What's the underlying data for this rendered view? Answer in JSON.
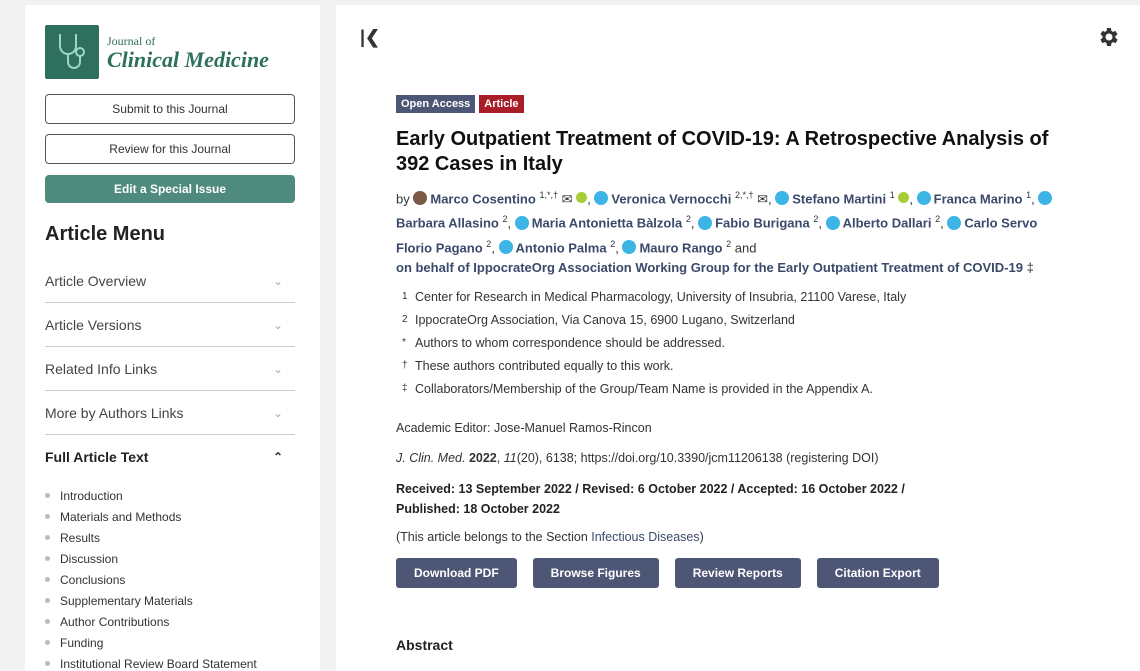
{
  "journal": {
    "line1": "Journal of",
    "line2": "Clinical Medicine"
  },
  "sidebar": {
    "submit_label": "Submit to this Journal",
    "review_label": "Review for this Journal",
    "special_issue_label": "Edit a Special Issue",
    "menu_title": "Article Menu",
    "menu_items": [
      {
        "label": "Article Overview"
      },
      {
        "label": "Article Versions"
      },
      {
        "label": "Related Info Links"
      },
      {
        "label": "More by Authors Links"
      },
      {
        "label": "Full Article Text"
      }
    ],
    "toc": [
      "Introduction",
      "Materials and Methods",
      "Results",
      "Discussion",
      "Conclusions",
      "Supplementary Materials",
      "Author Contributions",
      "Funding",
      "Institutional Review Board Statement"
    ]
  },
  "article": {
    "badges": [
      {
        "label": "Open Access",
        "color": "#4d5775"
      },
      {
        "label": "Article",
        "color": "#a91d28"
      }
    ],
    "title": "Early Outpatient Treatment of COVID-19: A Retrospective Analysis of 392 Cases in Italy",
    "by": "by",
    "authors": [
      {
        "name": "Marco Cosentino",
        "sup": "1,*,†"
      },
      {
        "name": "Veronica Vernocchi",
        "sup": "2,*,†"
      },
      {
        "name": "Stefano Martini",
        "sup": "1"
      },
      {
        "name": "Franca Marino",
        "sup": "1"
      },
      {
        "name": "Barbara Allasino",
        "sup": "2"
      },
      {
        "name": "Maria Antonietta Bàlzola",
        "sup": "2"
      },
      {
        "name": "Fabio Burigana",
        "sup": "2"
      },
      {
        "name": "Alberto Dallari",
        "sup": "2"
      },
      {
        "name": "Carlo Servo Florio Pagano",
        "sup": "2"
      },
      {
        "name": "Antonio Palma",
        "sup": "2"
      },
      {
        "name": "Mauro Rango",
        "sup": "2"
      }
    ],
    "and": "and",
    "behalf": "on behalf of IppocrateOrg Association Working Group for the Early Outpatient Treatment of COVID-19",
    "behalf_mark": "‡",
    "affiliations": [
      {
        "mark": "1",
        "text": "Center for Research in Medical Pharmacology, University of Insubria, 21100 Varese, Italy"
      },
      {
        "mark": "2",
        "text": "IppocrateOrg Association, Via Canova 15, 6900 Lugano, Switzerland"
      },
      {
        "mark": "*",
        "text": "Authors to whom correspondence should be addressed."
      },
      {
        "mark": "†",
        "text": "These authors contributed equally to this work."
      },
      {
        "mark": "‡",
        "text": "Collaborators/Membership of the Group/Team Name is provided in the Appendix A."
      }
    ],
    "editor": "Academic Editor: Jose-Manuel Ramos-Rincon",
    "cite_journal": "J. Clin. Med.",
    "cite_year": "2022",
    "cite_volume": "11",
    "cite_rest": "(20), 6138; https://doi.org/10.3390/jcm11206138 (registering DOI)",
    "dates": "Received: 13 September 2022 / Revised: 6 October 2022 / Accepted: 16 October 2022 / Published: 18 October 2022",
    "section_prefix": "(This article belongs to the Section ",
    "section_name": "Infectious Diseases",
    "section_suffix": ")",
    "buttons": [
      "Download PDF",
      "Browse Figures",
      "Review Reports",
      "Citation Export"
    ],
    "abstract_heading": "Abstract"
  }
}
